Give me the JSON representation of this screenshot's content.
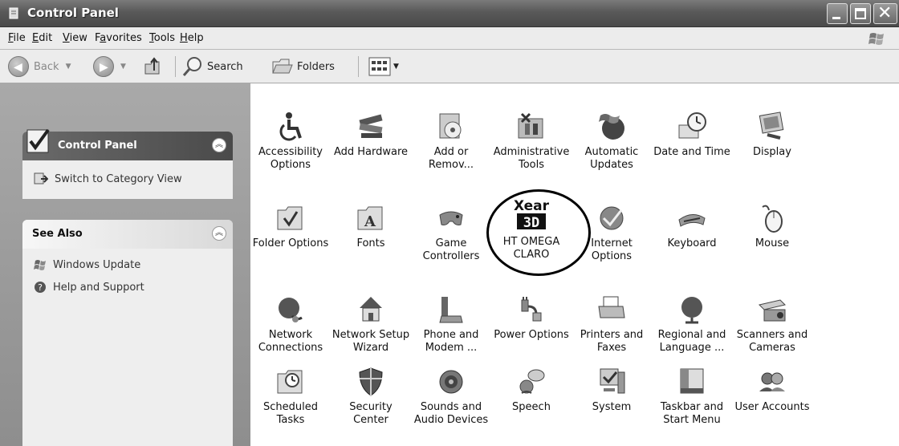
{
  "window": {
    "title": "Control Panel"
  },
  "menu": [
    {
      "label": "File",
      "accel": "F",
      "rest": "ile"
    },
    {
      "label": "Edit",
      "accel": "E",
      "rest": "dit"
    },
    {
      "label": "View",
      "accel": "V",
      "rest": "iew"
    },
    {
      "label": "Favorites",
      "pre": "F",
      "accel": "a",
      "rest": "vorites"
    },
    {
      "label": "Tools",
      "accel": "T",
      "rest": "ools"
    },
    {
      "label": "Help",
      "accel": "H",
      "rest": "elp"
    }
  ],
  "toolbar": {
    "back": "Back",
    "search": "Search",
    "folders": "Folders"
  },
  "sidebar": {
    "panel_title": "Control Panel",
    "switch_view": "Switch to Category View",
    "see_also_title": "See Also",
    "see_also_items": [
      "Windows Update",
      "Help and Support"
    ]
  },
  "icons": [
    {
      "l1": "Accessibility",
      "l2": "Options",
      "icon": "accessibility-icon"
    },
    {
      "l1": "Add Hardware",
      "l2": "",
      "icon": "hardware-icon"
    },
    {
      "l1": "Add or",
      "l2": "Remov...",
      "icon": "add-remove-icon"
    },
    {
      "l1": "Administrative",
      "l2": "Tools",
      "icon": "admin-tools-icon"
    },
    {
      "l1": "Automatic",
      "l2": "Updates",
      "icon": "updates-icon"
    },
    {
      "l1": "Date and Time",
      "l2": "",
      "icon": "clock-icon"
    },
    {
      "l1": "Display",
      "l2": "",
      "icon": "display-icon"
    },
    {
      "l1": "Folder Options",
      "l2": "",
      "icon": "folder-options-icon"
    },
    {
      "l1": "Fonts",
      "l2": "",
      "icon": "fonts-icon"
    },
    {
      "l1": "Game",
      "l2": "Controllers",
      "icon": "gamepad-icon"
    },
    {
      "l1": "HT OMEGA",
      "l2": "CLARO",
      "icon": "xear-3d-icon"
    },
    {
      "l1": "Internet",
      "l2": "Options",
      "icon": "globe-icon"
    },
    {
      "l1": "Keyboard",
      "l2": "",
      "icon": "keyboard-icon"
    },
    {
      "l1": "Mouse",
      "l2": "",
      "icon": "mouse-icon"
    },
    {
      "l1": "Network",
      "l2": "Connections",
      "icon": "network-icon"
    },
    {
      "l1": "Network Setup",
      "l2": "Wizard",
      "icon": "network-wizard-icon"
    },
    {
      "l1": "Phone and",
      "l2": "Modem ...",
      "icon": "phone-icon"
    },
    {
      "l1": "Power Options",
      "l2": "",
      "icon": "power-icon"
    },
    {
      "l1": "Printers and",
      "l2": "Faxes",
      "icon": "printer-icon"
    },
    {
      "l1": "Regional and",
      "l2": "Language ...",
      "icon": "world-icon"
    },
    {
      "l1": "Scanners and",
      "l2": "Cameras",
      "icon": "scanner-icon"
    },
    {
      "l1": "Scheduled",
      "l2": "Tasks",
      "icon": "scheduled-tasks-icon"
    },
    {
      "l1": "Security",
      "l2": "Center",
      "icon": "shield-icon"
    },
    {
      "l1": "Sounds and",
      "l2": "Audio Devices",
      "icon": "speaker-icon"
    },
    {
      "l1": "Speech",
      "l2": "",
      "icon": "speech-icon"
    },
    {
      "l1": "System",
      "l2": "",
      "icon": "system-icon"
    },
    {
      "l1": "Taskbar and",
      "l2": "Start Menu",
      "icon": "taskbar-icon"
    },
    {
      "l1": "User Accounts",
      "l2": "",
      "icon": "users-icon"
    }
  ],
  "xear_logo": {
    "line1": "Xear",
    "line2": "3D"
  }
}
